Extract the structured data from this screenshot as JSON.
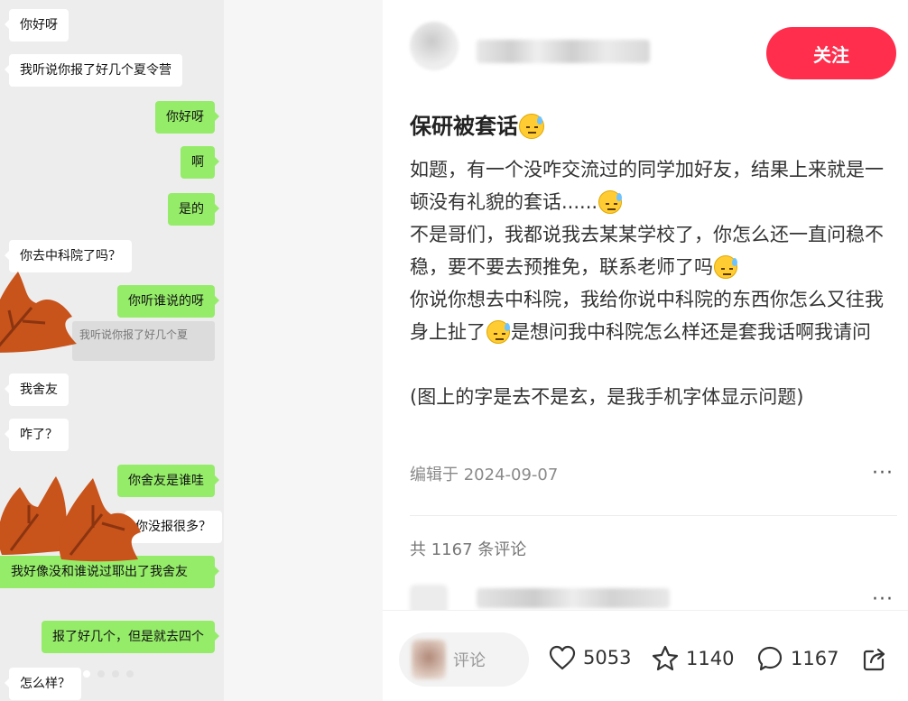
{
  "chat_image": {
    "messages": [
      {
        "side": "left",
        "text": "你好呀"
      },
      {
        "side": "left",
        "text": "我听说你报了好几个夏令营"
      },
      {
        "side": "right",
        "text": "你好呀"
      },
      {
        "side": "right",
        "text": "啊"
      },
      {
        "side": "right",
        "text": "是的"
      },
      {
        "side": "left",
        "text": "你去中科院了吗？"
      },
      {
        "side": "right",
        "text": "你听谁说的呀"
      },
      {
        "side": "left",
        "text": "我舍友"
      },
      {
        "side": "left",
        "text": "咋了？"
      },
      {
        "side": "right",
        "text": "你舍友是谁哇"
      },
      {
        "side": "left",
        "text": "你没报很多？"
      },
      {
        "side": "right",
        "text": "我好像没和谁说过耶出了我舍友"
      },
      {
        "side": "right",
        "text": "报了好几个，但是就去四个"
      },
      {
        "side": "left",
        "text": "怎么样？"
      }
    ],
    "quote_text": "我听说你报了好几个夏",
    "carousel_total": 4,
    "carousel_active": 1
  },
  "note": {
    "follow_label": "关注",
    "title": "保研被套话",
    "body": {
      "line1": "如题，有一个没咋交流过的同学加好友，结果上来就是一顿没有礼貌的套话......",
      "line2": "不是哥们，我都说我去某某学校了，你怎么还一直问稳不稳，要不要去预推免，联系老师了吗",
      "line3a": "你说你想去中科院，我给你说中科院的东西你怎么又往我身上扯了",
      "line3b": "是想问我中科院怎么样还是套我话啊我请问",
      "line4": "(图上的字是去不是玄，是我手机字体显示问题)"
    },
    "edit_date": "编辑于 2024-09-07",
    "more_label": "···",
    "comment_count": "共 1167 条评论",
    "comment_more_label": "···"
  },
  "bottom_bar": {
    "comment_placeholder": "评论",
    "likes": "5053",
    "collects": "1140",
    "comments": "1167"
  },
  "colors": {
    "accent": "#ff2e4d",
    "chat_green": "#95ec69",
    "leaf": "#c8531b"
  },
  "icons": [
    "heart-icon",
    "star-icon",
    "comment-icon",
    "share-icon",
    "sweat-emoji-icon",
    "leaf-sticker-icon"
  ]
}
